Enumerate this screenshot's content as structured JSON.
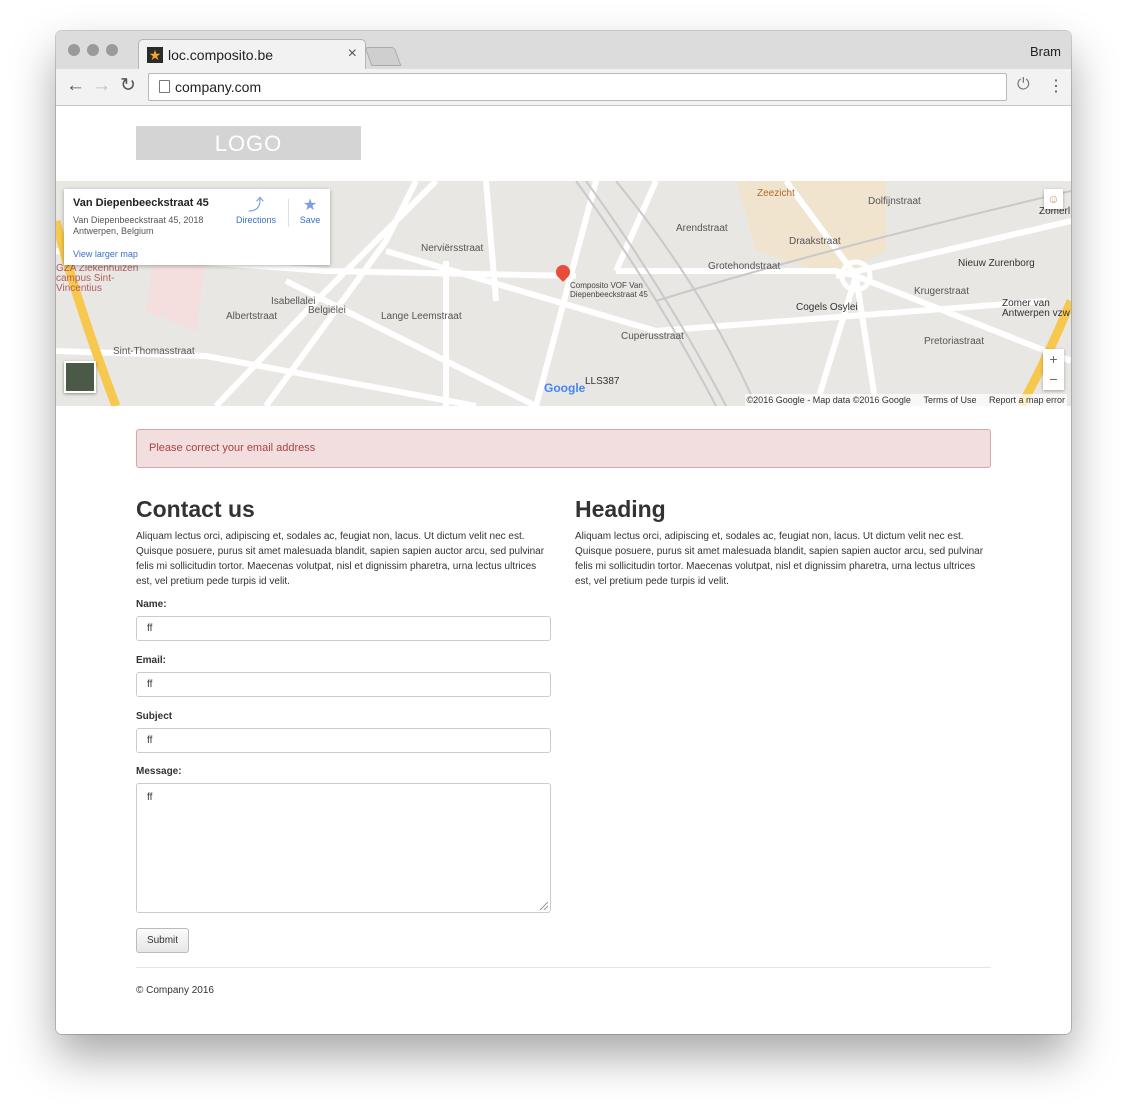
{
  "browser": {
    "tab_title": "loc.composito.be",
    "tab_close": "×",
    "user": "Bram",
    "url": "company.com"
  },
  "page": {
    "logo_text": "LOGO",
    "map": {
      "place_title": "Van Diepenbeeckstraat 45",
      "place_address": "Van Diepenbeeckstraat 45, 2018 Antwerpen, Belgium",
      "directions_label": "Directions",
      "save_label": "Save",
      "view_larger": "View larger map",
      "marker_label": "Composito VOF Van Diepenbeeckstraat 45",
      "google_logo": "Google",
      "attribution": "©2016 Google - Map data ©2016 Google",
      "terms": "Terms of Use",
      "report": "Report a map error",
      "zoom_in": "+",
      "zoom_out": "−",
      "street_labels": [
        "Zeezicht",
        "Arendstraat",
        "Grotehondstraat",
        "Draakstraat",
        "Nieuw Zurenborg",
        "Cogels Osylei",
        "Zomer van Antwerpen vzw",
        "Nerviërsstraat",
        "Lange Leemstraat",
        "Sint-Thomasstraat",
        "GZA Ziekenhuizen campus Sint-Vincentius",
        "Albertstraat",
        "Isabellalei",
        "Belgiëlei",
        "Cuperusstraat",
        "LLS387",
        "Krugerstraat",
        "Pretoriastraat",
        "Dolfijnstraat",
        "Zomerl"
      ]
    },
    "alert": "Please correct your email address",
    "contact": {
      "heading": "Contact us",
      "body": "Aliquam lectus orci, adipiscing et, sodales ac, feugiat non, lacus. Ut dictum velit nec est. Quisque posuere, purus sit amet malesuada blandit, sapien sapien auctor arcu, sed pulvinar felis mi sollicitudin tortor. Maecenas volutpat, nisl et dignissim pharetra, urna lectus ultrices est, vel pretium pede turpis id velit.",
      "name_label": "Name:",
      "name_value": "ff",
      "email_label": "Email:",
      "email_value": "ff",
      "subject_label": "Subject",
      "subject_value": "ff",
      "message_label": "Message:",
      "message_value": "ff",
      "submit": "Submit"
    },
    "side": {
      "heading": "Heading",
      "body": "Aliquam lectus orci, adipiscing et, sodales ac, feugiat non, lacus. Ut dictum velit nec est. Quisque posuere, purus sit amet malesuada blandit, sapien sapien auctor arcu, sed pulvinar felis mi sollicitudin tortor. Maecenas volutpat, nisl et dignissim pharetra, urna lectus ultrices est, vel pretium pede turpis id velit."
    },
    "footer": "© Company 2016"
  }
}
